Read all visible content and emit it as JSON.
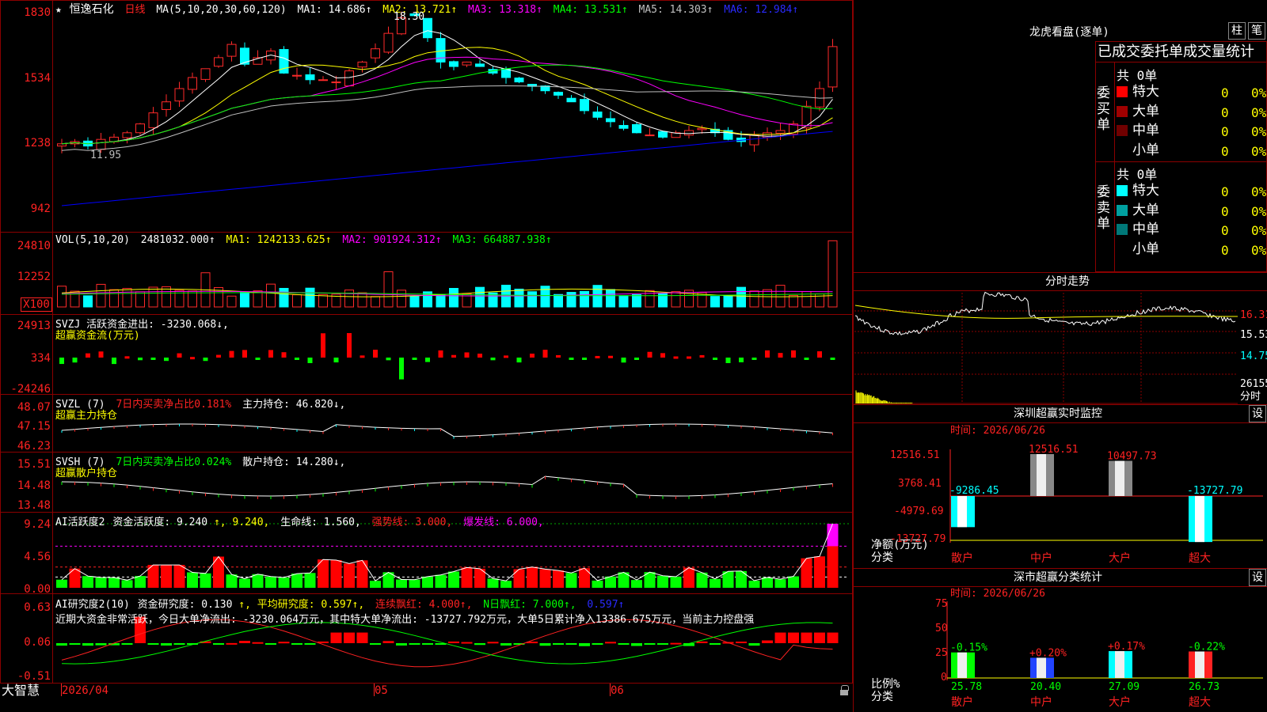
{
  "stock": {
    "name": "恒逸石化",
    "period": "日线",
    "star": "★"
  },
  "ma_header": {
    "label": "MA(5,10,20,30,60,120)",
    "ma1": "MA1: 14.686↑",
    "ma2": "MA2: 13.721↑",
    "ma3": "MA3: 13.318↑",
    "ma4": "MA4: 13.531↑",
    "ma5": "MA5: 14.303↑",
    "ma6": "MA6: 12.984↑"
  },
  "price_axis": [
    "1830",
    "1534",
    "1238",
    "942"
  ],
  "price_annotations": {
    "high": "18.30",
    "low": "11.95"
  },
  "vol_header": {
    "label": "VOL(5,10,20)",
    "value": "2481032.000↑",
    "ma1": "MA1: 1242133.625↑",
    "ma2": "MA2: 901924.312↑",
    "ma3": "MA3: 664887.938↑"
  },
  "vol_axis": [
    "24810",
    "12252"
  ],
  "vol_unit": "X100",
  "svzj": {
    "header": "SVZJ  活跃资金进出: -3230.068↓,",
    "title": "超赢资金流(万元)",
    "axis": [
      "24913",
      "334",
      "-24246"
    ]
  },
  "svzl": {
    "label": "SVZL (7)",
    "ratio": "7日内买卖净占比0.181%",
    "hold": "主力持仓: 46.820↓,",
    "title": "超赢主力持仓",
    "axis": [
      "48.07",
      "47.15",
      "46.23"
    ]
  },
  "svsh": {
    "label": "SVSH (7)",
    "ratio": "7日内买卖净占比0.024%",
    "hold": "散户持仓: 14.280↓,",
    "title": "超赢散户持仓",
    "axis": [
      "15.51",
      "14.48",
      "13.48"
    ]
  },
  "ai_active": {
    "label": "AI活跃度2",
    "act": "资金活跃度: 9.240",
    "v2": "↑, 9.240,",
    "life": "生命线: 1.560,",
    "strong": "强势线: 3.000,",
    "burst": "爆发线: 6.000,",
    "axis": [
      "9.24",
      "4.56",
      "0.00"
    ]
  },
  "ai_research": {
    "label": "AI研究度2(10)",
    "res": "资金研究度: 0.130",
    "avg": "↑, 平均研究度: 0.597↑,",
    "streak": "连续飘红: 4.000↑,",
    "nday": "N日飘红: 7.000↑,",
    "last": "0.597↑",
    "summary": "近期大资金非常活跃，今日大单净流出: -3230.064万元，其中特大单净流出: -13727.792万元，大单5日累计净入13386.675万元，当前主力控盘强",
    "axis": [
      "0.63",
      "0.06",
      "-0.51"
    ]
  },
  "date_axis": {
    "d1": "2026/04",
    "d2": "05",
    "d3": "06"
  },
  "footer_left": "大智慧",
  "lhb": {
    "title": "龙虎看盘(逐单)",
    "btn1": "柱",
    "btn2": "笔",
    "col_header": "已成交委托单成交量统计",
    "buy": {
      "label": "委买单",
      "total": "共 0单",
      "rows": [
        {
          "name": "特大",
          "v": "0",
          "p": "0%",
          "color": "#ff0000"
        },
        {
          "name": "大单",
          "v": "0",
          "p": "0%",
          "color": "#a00000"
        },
        {
          "name": "中单",
          "v": "0",
          "p": "0%",
          "color": "#700000"
        },
        {
          "name": "小单",
          "v": "0",
          "p": "0%",
          "color": "#000000"
        }
      ]
    },
    "sell": {
      "label": "委卖单",
      "total": "共 0单",
      "rows": [
        {
          "name": "特大",
          "v": "0",
          "p": "0%",
          "color": "#00ffff"
        },
        {
          "name": "大单",
          "v": "0",
          "p": "0%",
          "color": "#00a0a0"
        },
        {
          "name": "中单",
          "v": "0",
          "p": "0%",
          "color": "#007878"
        },
        {
          "name": "小单",
          "v": "0",
          "p": "0%",
          "color": "#000000"
        }
      ]
    }
  },
  "fenshi": {
    "title": "分时走势",
    "axis": [
      "16.31",
      "15.53",
      "14.75",
      "26155"
    ],
    "unit": "分时"
  },
  "sz_monitor": {
    "title": "深圳超赢实时监控",
    "btn": "设",
    "time": "时间: 2026/06/26",
    "axis": [
      "12516.51",
      "3768.41",
      "-4979.69",
      "-13727.79"
    ],
    "ylabel": "净额(万元)",
    "xlabel": "分类",
    "bars": [
      {
        "name": "散户",
        "label": "-9286.45",
        "value": -9286.45
      },
      {
        "name": "中户",
        "label": "12516.51",
        "value": 12516.51
      },
      {
        "name": "大户",
        "label": "10497.73",
        "value": 10497.73
      },
      {
        "name": "超大",
        "label": "-13727.79",
        "value": -13727.79
      }
    ]
  },
  "sz_class": {
    "title": "深市超赢分类统计",
    "btn": "设",
    "time": "时间: 2026/06/26",
    "axis": [
      "75",
      "50",
      "25",
      "0"
    ],
    "ylabel": "比例%",
    "xlabel": "分类",
    "bars": [
      {
        "name": "散户",
        "change": "-0.15%",
        "value": 25.78,
        "label": "25.78"
      },
      {
        "name": "中户",
        "change": "+0.20%",
        "value": 20.4,
        "label": "20.40"
      },
      {
        "name": "大户",
        "change": "+0.17%",
        "value": 27.09,
        "label": "27.09"
      },
      {
        "name": "超大",
        "change": "-0.22%",
        "value": 26.73,
        "label": "26.73"
      }
    ]
  },
  "colors": {
    "up": "#ff2a2a",
    "down": "#00ffff",
    "ma1": "#ffffff",
    "ma2": "#ffff00",
    "ma3": "#ff00ff",
    "ma4": "#00ff00",
    "ma5": "#c0c0c0",
    "ma6": "#0000ff",
    "grid": "#8b0000"
  }
}
